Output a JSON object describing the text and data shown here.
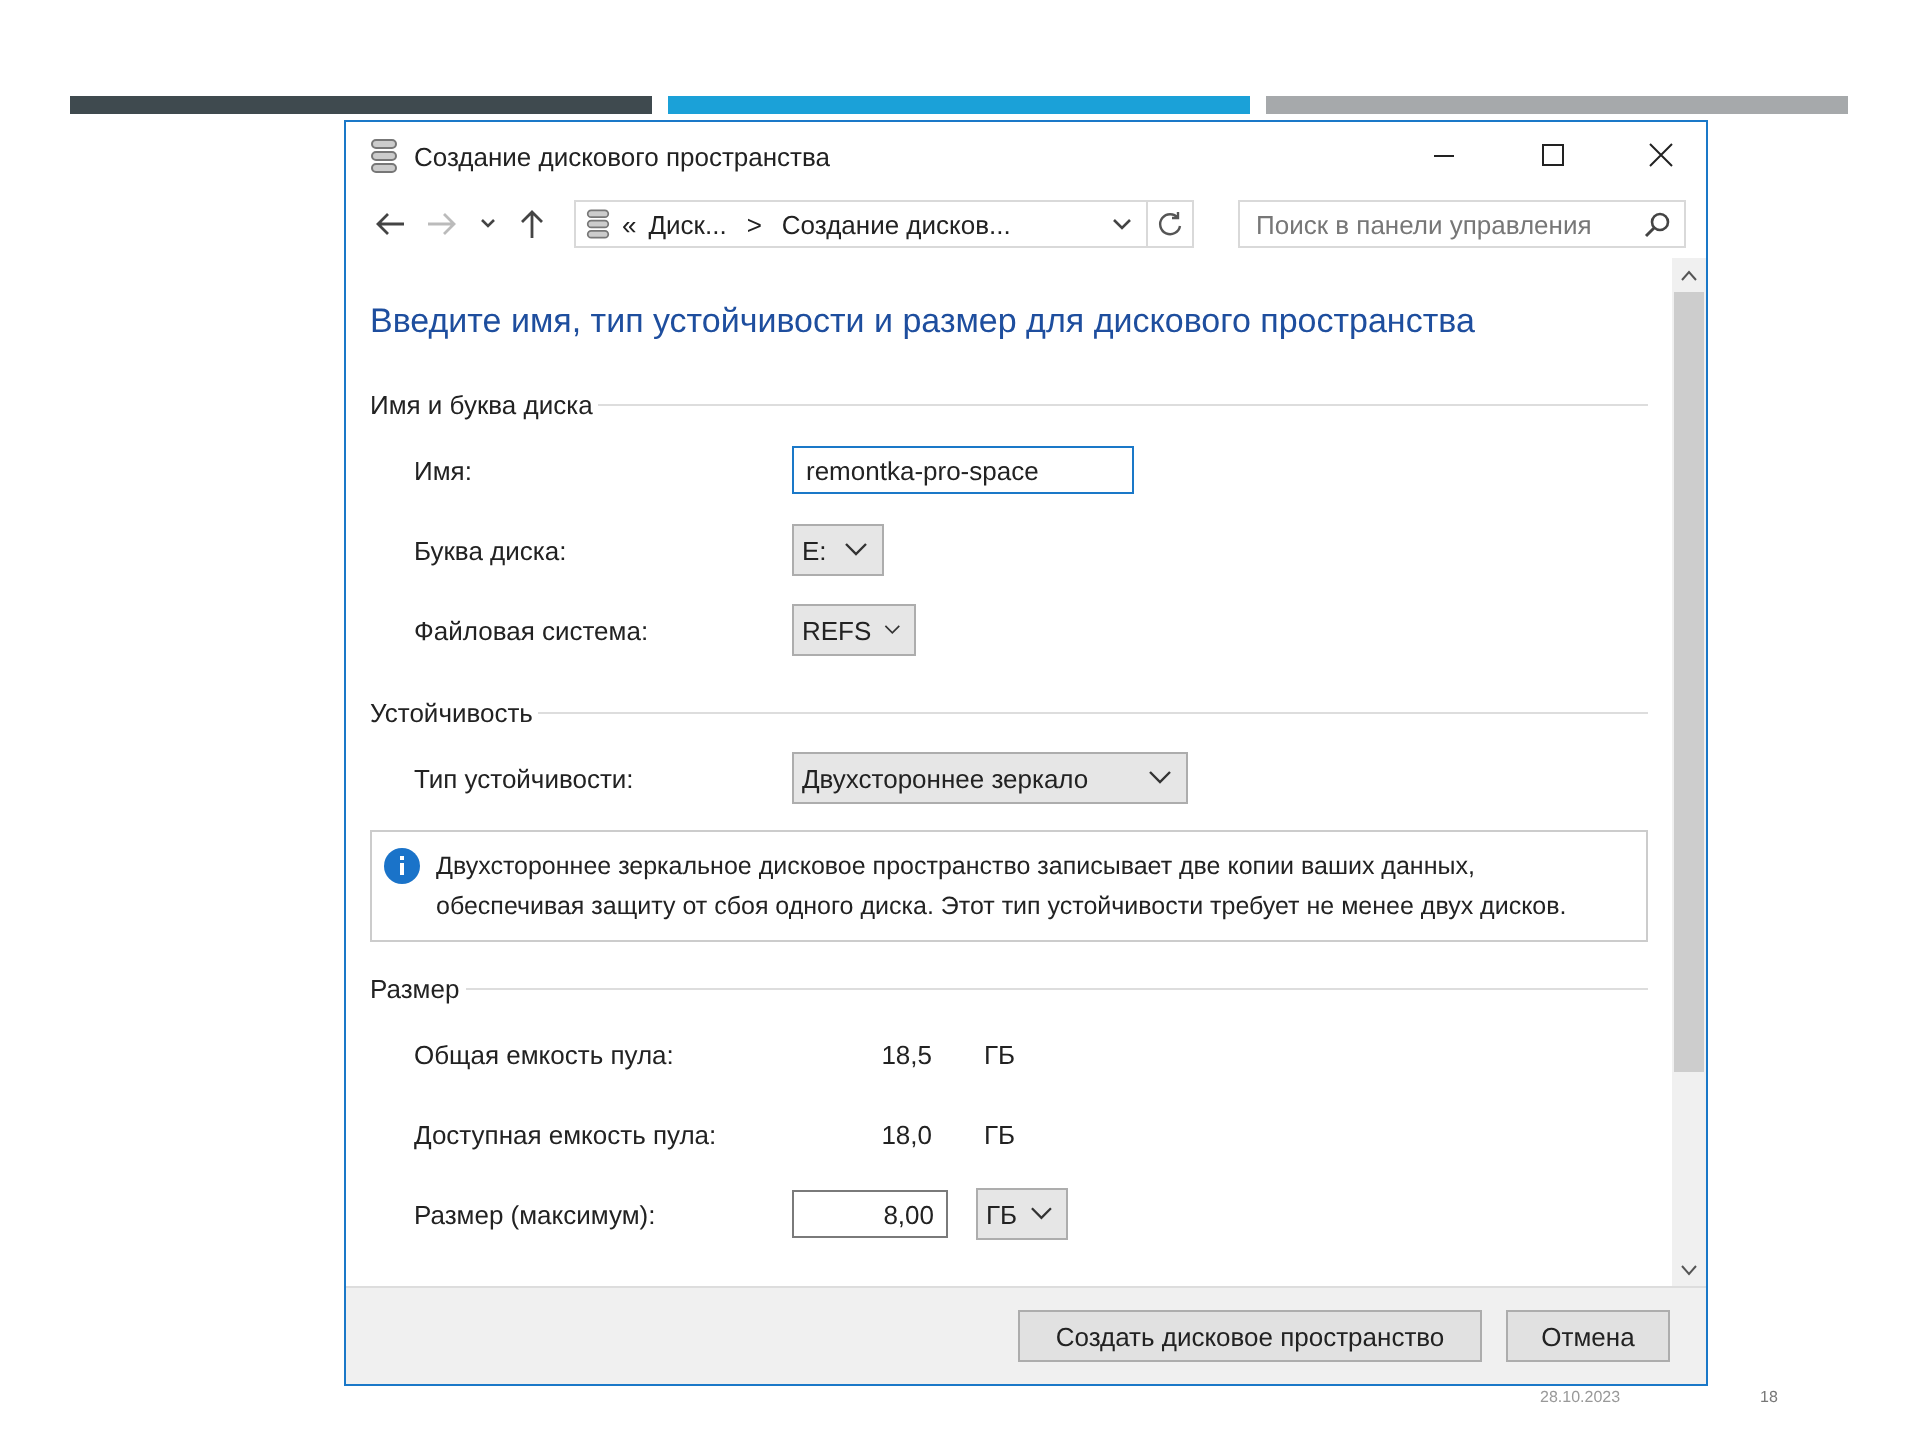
{
  "slide": {
    "bars": [
      {
        "color": "#3f4a4f"
      },
      {
        "color": "#1ba1d8"
      },
      {
        "color": "#a6a9ab"
      }
    ],
    "date": "28.10.2023",
    "page_number": "18"
  },
  "window": {
    "title": "Создание дискового пространства"
  },
  "address": {
    "prefix": "«",
    "crumbs": [
      "Диск...",
      "Создание дисков..."
    ],
    "separator": ">"
  },
  "search": {
    "placeholder": "Поиск в панели управления"
  },
  "heading": "Введите имя, тип устойчивости и размер для дискового пространства",
  "sections": [
    {
      "title": "Имя и буква диска",
      "items": [
        {
          "kind": "text",
          "label": "Имя:",
          "value": "remontka-pro-space"
        },
        {
          "kind": "select",
          "label": "Буква диска:",
          "value": "E:"
        },
        {
          "kind": "select",
          "label": "Файловая система:",
          "value": "REFS"
        }
      ]
    },
    {
      "title": "Устойчивость",
      "items": [
        {
          "kind": "select",
          "label": "Тип устойчивости:",
          "value": "Двухстороннее зеркало"
        },
        {
          "kind": "info",
          "text": "Двухстороннее зеркальное дисковое пространство записывает две копии ваших данных, обеспечивая защиту от сбоя одного диска. Этот тип устойчивости требует не менее двух дисков."
        }
      ]
    },
    {
      "title": "Размер",
      "items": [
        {
          "kind": "readout",
          "label": "Общая емкость пула:",
          "value": "18,5",
          "unit": "ГБ"
        },
        {
          "kind": "readout",
          "label": "Доступная емкость пула:",
          "value": "18,0",
          "unit": "ГБ"
        },
        {
          "kind": "size",
          "label": "Размер (максимум):",
          "value": "8,00",
          "unit": "ГБ"
        }
      ]
    }
  ],
  "buttons": [
    "Создать дисковое пространство",
    "Отмена"
  ]
}
